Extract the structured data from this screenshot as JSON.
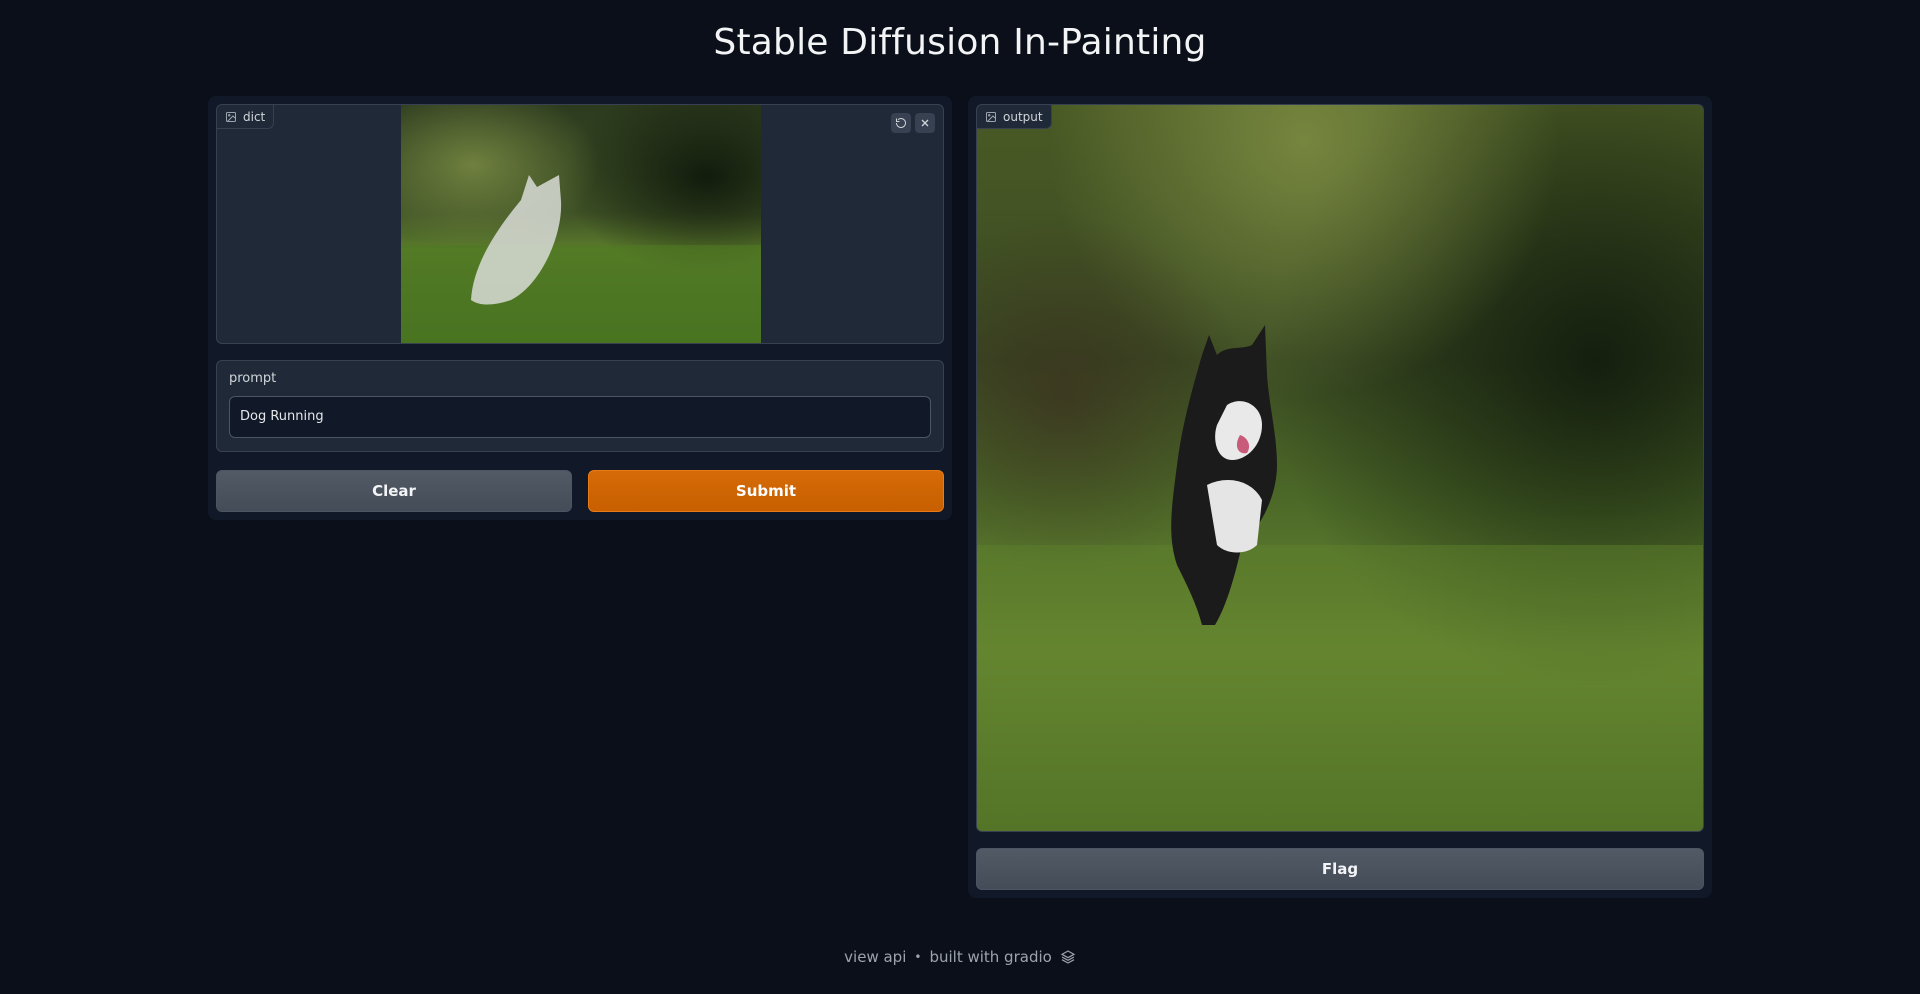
{
  "title": "Stable Diffusion In-Painting",
  "input_image": {
    "label": "dict",
    "icons": [
      "image-icon",
      "undo-icon",
      "close-icon"
    ]
  },
  "prompt": {
    "label": "prompt",
    "value": "Dog Running"
  },
  "buttons": {
    "clear": "Clear",
    "submit": "Submit",
    "flag": "Flag"
  },
  "output_image": {
    "label": "output"
  },
  "footer": {
    "view_api": "view api",
    "separator": "•",
    "built_with": "built with gradio"
  },
  "colors": {
    "background": "#0b0f19",
    "panel": "#111827",
    "accent": "#d46508",
    "button": "#4b5563"
  }
}
